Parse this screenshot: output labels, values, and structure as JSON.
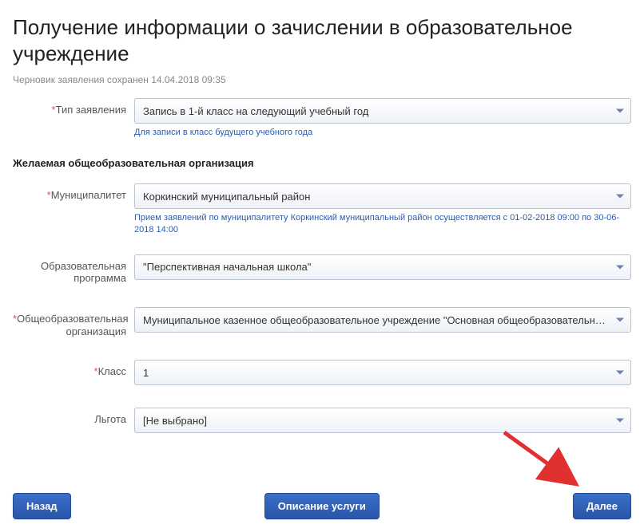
{
  "page_title": "Получение информации о зачислении в образовательное учреждение",
  "draft_saved": "Черновик заявления сохранен 14.04.2018 09:35",
  "section_title": "Желаемая общеобразовательная организация",
  "labels": {
    "application_type": "Тип заявления",
    "municipality": "Муниципалитет",
    "education_program": "Образовательная программа",
    "organization": "Общеобразовательная организация",
    "class": "Класс",
    "benefit": "Льгота"
  },
  "values": {
    "application_type": "Запись в 1-й класс на следующий учебный год",
    "municipality": "Коркинский муниципальный район",
    "education_program": "\"Перспективная начальная школа\"",
    "organization": "Муниципальное казенное общеобразовательное учреждение \"Основная общеобразовательная ш...",
    "class": "1",
    "benefit": "[Не выбрано]"
  },
  "hints": {
    "application_type": "Для записи в класс будущего учебного года",
    "municipality": "Прием заявлений по муниципалитету Коркинский муниципальный район осуществляется с 01-02-2018 09:00 по 30-06-2018 14:00"
  },
  "buttons": {
    "back": "Назад",
    "description": "Описание услуги",
    "next": "Далее"
  }
}
